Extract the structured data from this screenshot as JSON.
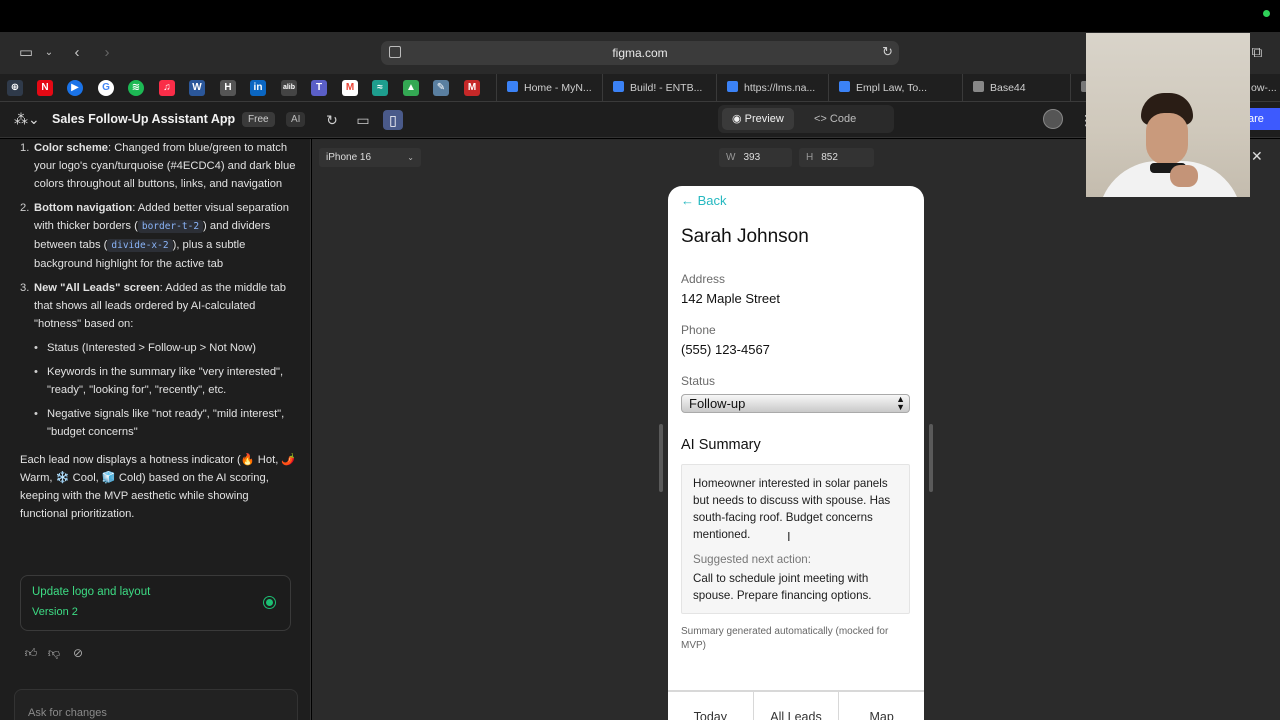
{
  "browser": {
    "url": "figma.com",
    "favicons": [
      {
        "name": "netflix",
        "letter": "N",
        "color": "#e50914"
      },
      {
        "name": "play",
        "letter": "▶",
        "color": "#1a73e8"
      },
      {
        "name": "google",
        "letter": "G",
        "color": "#ffffff"
      },
      {
        "name": "spotify",
        "letter": "≋",
        "color": "#1db954"
      },
      {
        "name": "music",
        "letter": "♫",
        "color": "#fa2d48"
      },
      {
        "name": "word",
        "letter": "W",
        "color": "#2b579a"
      },
      {
        "name": "hbr",
        "letter": "H",
        "color": "#555555"
      },
      {
        "name": "linkedin",
        "letter": "in",
        "color": "#0a66c2"
      },
      {
        "name": "alib",
        "letter": "alib",
        "color": "#444444"
      },
      {
        "name": "teams",
        "letter": "T",
        "color": "#5b5fc7"
      },
      {
        "name": "gmail",
        "letter": "M",
        "color": "#ea4335"
      },
      {
        "name": "app",
        "letter": "≈",
        "color": "#1e9e8e"
      },
      {
        "name": "drive",
        "letter": "▲",
        "color": "#34a853"
      },
      {
        "name": "tool",
        "letter": "✎",
        "color": "#5a7fa0"
      },
      {
        "name": "m-red",
        "letter": "M",
        "color": "#c62828"
      }
    ],
    "tabs": [
      {
        "label": "Home - MyN...",
        "color": "#3b82f6"
      },
      {
        "label": "Build! - ENTB...",
        "color": "#3b82f6"
      },
      {
        "label": "https://lms.na...",
        "color": "#3b82f6"
      },
      {
        "label": "Empl Law, To...",
        "color": "#3b82f6"
      },
      {
        "label": "Base44",
        "color": "#888888"
      },
      {
        "label": "F",
        "color": "#777777"
      },
      {
        "label": "ow-...",
        "color": "#777777"
      }
    ]
  },
  "figma": {
    "project_title": "Sales Follow-Up Assistant App",
    "plan_badge": "Free",
    "ai_badge": "AI",
    "modes": {
      "preview": "Preview",
      "code": "Code"
    },
    "share_label": "are",
    "device": "iPhone 16",
    "width_label": "W",
    "width_value": "393",
    "height_label": "H",
    "height_value": "852"
  },
  "chat": {
    "item1_num": "1.",
    "item1_bold": "Color scheme",
    "item1_text": ": Changed from blue/green to match your logo's cyan/turquoise (#4ECDC4) and dark blue colors throughout all buttons, links, and navigation",
    "item2_num": "2.",
    "item2_bold": "Bottom navigation",
    "item2_text_a": ": Added better visual separation with thicker borders (",
    "item2_code_a": "border-t-2",
    "item2_text_b": ") and dividers between tabs (",
    "item2_code_b": "divide-x-2",
    "item2_text_c": "), plus a subtle background highlight for the active tab",
    "item3_num": "3.",
    "item3_bold": "New \"All Leads\" screen",
    "item3_text": ": Added as the middle tab that shows all leads ordered by AI-calculated \"hotness\" based on:",
    "subitems": [
      "Status (Interested > Follow-up > Not Now)",
      "Keywords in the summary like \"very interested\", \"ready\", \"looking for\", \"recently\", etc.",
      "Negative signals like \"not ready\", \"mild interest\", \"budget concerns\""
    ],
    "closing": "Each lead now displays a hotness indicator (🔥 Hot, 🌶️ Warm, ❄️ Cool, 🧊 Cold) based on the AI scoring, keeping with the MVP aesthetic while showing functional prioritization.",
    "version_title": "Update logo and layout",
    "version_label": "Version 2",
    "ask_placeholder": "Ask for changes"
  },
  "preview": {
    "back_label": "← Back",
    "lead_name": "Sarah Johnson",
    "address_label": "Address",
    "address_value": "142 Maple Street",
    "phone_label": "Phone",
    "phone_value": "(555) 123-4567",
    "status_label": "Status",
    "status_value": "Follow-up",
    "ai_summary_title": "AI Summary",
    "ai_summary_text": "Homeowner interested in solar panels but needs to discuss with spouse. Has south-facing roof. Budget concerns mentioned.",
    "next_action_label": "Suggested next action:",
    "next_action_text": "Call to schedule joint meeting with spouse. Prepare financing options.",
    "summary_footnote": "Summary generated automatically (mocked for MVP)",
    "nav_tabs": [
      "Today",
      "All Leads",
      "Map"
    ]
  }
}
